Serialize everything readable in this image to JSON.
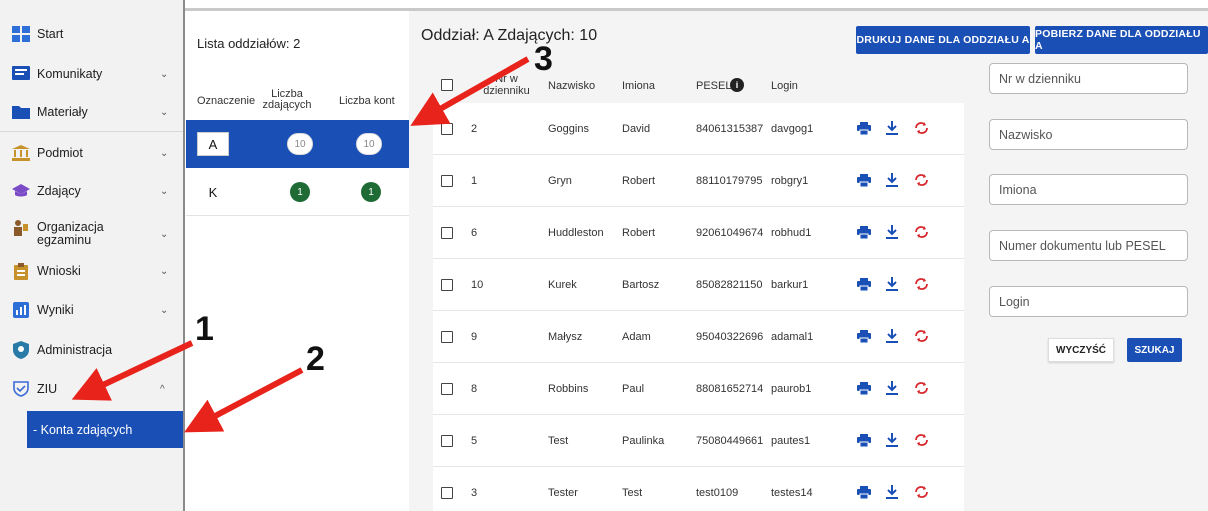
{
  "sidebar": {
    "items": [
      {
        "label": "Start",
        "icon": "grid-icon",
        "chevron": ""
      },
      {
        "label": "Komunikaty",
        "icon": "message-icon",
        "chevron": "⌄"
      },
      {
        "label": "Materiały",
        "icon": "folder-icon",
        "chevron": "⌄"
      },
      {
        "label": "Podmiot",
        "icon": "institution-icon",
        "chevron": "⌄"
      },
      {
        "label": "Zdający",
        "icon": "graduation-cap-icon",
        "chevron": "⌄"
      },
      {
        "label": "Organizacja egzaminu",
        "icon": "presenter-icon",
        "chevron": "⌄"
      },
      {
        "label": "Wnioski",
        "icon": "clipboard-icon",
        "chevron": "⌄"
      },
      {
        "label": "Wyniki",
        "icon": "bar-chart-icon",
        "chevron": "⌄"
      },
      {
        "label": "Administracja",
        "icon": "shield-icon",
        "chevron": ""
      },
      {
        "label": "ZIU",
        "icon": "shield-check-icon",
        "chevron": "^"
      }
    ],
    "sub_item": "- Konta zdających"
  },
  "groups": {
    "title": "Lista oddziałów: 2",
    "headers": {
      "code": "Oznaczenie",
      "count": "Liczba zdających",
      "accounts": "Liczba kont"
    },
    "rows": [
      {
        "code": "A",
        "count": "10",
        "accounts": "10",
        "selected": true
      },
      {
        "code": "K",
        "count": "1",
        "accounts": "1",
        "selected": false
      }
    ]
  },
  "main": {
    "title": "Oddział: A Zdających: 10",
    "print_button": "DRUKUJ DANE DLA ODDZIAŁU A",
    "download_button": "POBIERZ DANE DLA ODDZIAŁU A",
    "columns": {
      "nr": "Nr w dzienniku",
      "surname": "Nazwisko",
      "names": "Imiona",
      "pesel": "PESEL",
      "login": "Login"
    },
    "rows": [
      {
        "nr": "2",
        "surname": "Goggins",
        "names": "David",
        "pesel": "84061315387",
        "login": "davgog1"
      },
      {
        "nr": "1",
        "surname": "Gryn",
        "names": "Robert",
        "pesel": "88110179795",
        "login": "robgry1"
      },
      {
        "nr": "6",
        "surname": "Huddleston",
        "names": "Robert",
        "pesel": "92061049674",
        "login": "robhud1"
      },
      {
        "nr": "10",
        "surname": "Kurek",
        "names": "Bartosz",
        "pesel": "85082821150",
        "login": "barkur1"
      },
      {
        "nr": "9",
        "surname": "Małysz",
        "names": "Adam",
        "pesel": "95040322696",
        "login": "adamal1"
      },
      {
        "nr": "8",
        "surname": "Robbins",
        "names": "Paul",
        "pesel": "88081652714",
        "login": "paurob1"
      },
      {
        "nr": "5",
        "surname": "Test",
        "names": "Paulinka",
        "pesel": "75080449661",
        "login": "pautes1"
      },
      {
        "nr": "3",
        "surname": "Tester",
        "names": "Test",
        "pesel": "test0109",
        "login": "testes14"
      }
    ]
  },
  "filters": {
    "nr_placeholder": "Nr w dzienniku",
    "surname_placeholder": "Nazwisko",
    "names_placeholder": "Imiona",
    "doc_placeholder": "Numer dokumentu lub PESEL",
    "login_placeholder": "Login",
    "clear_button": "WYCZYŚĆ",
    "search_button": "SZUKAJ"
  },
  "annotations": {
    "one": "1",
    "two": "2",
    "three": "3"
  },
  "colors": {
    "accent": "#1a4fb5",
    "green": "#1f6b35",
    "refresh": "#d8262b",
    "arrow": "#e8231c"
  }
}
